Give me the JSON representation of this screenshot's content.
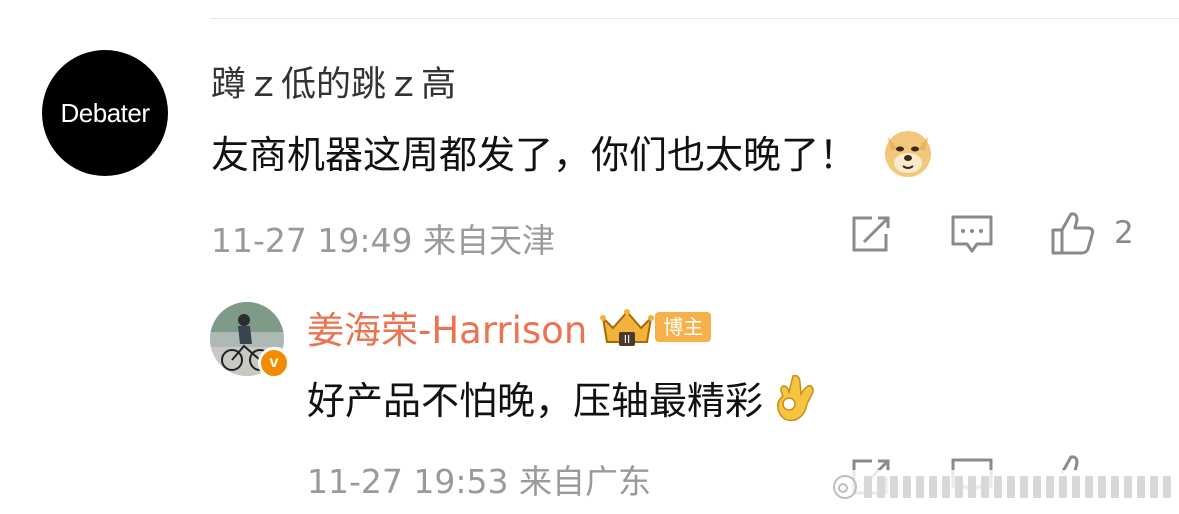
{
  "comment": {
    "avatar_text": "Debater",
    "username": "蹲ｚ低的跳ｚ高",
    "text": "友商机器这周都发了，你们也太晚了！",
    "emoji": "doge-emoji",
    "timestamp": "11-27 19:49",
    "location": "来自天津",
    "like_count": "2"
  },
  "reply": {
    "username": "姜海荣-Harrison",
    "badge_label": "博主",
    "verified_mark": "v",
    "text": "好产品不怕晚，压轴最精彩",
    "emoji": "ok-hand-emoji",
    "timestamp": "11-27 19:53",
    "location": "来自广东"
  },
  "colors": {
    "username_highlight": "#eb7350",
    "meta_gray": "#9a9a9a",
    "badge_orange": "#f7b14b"
  }
}
